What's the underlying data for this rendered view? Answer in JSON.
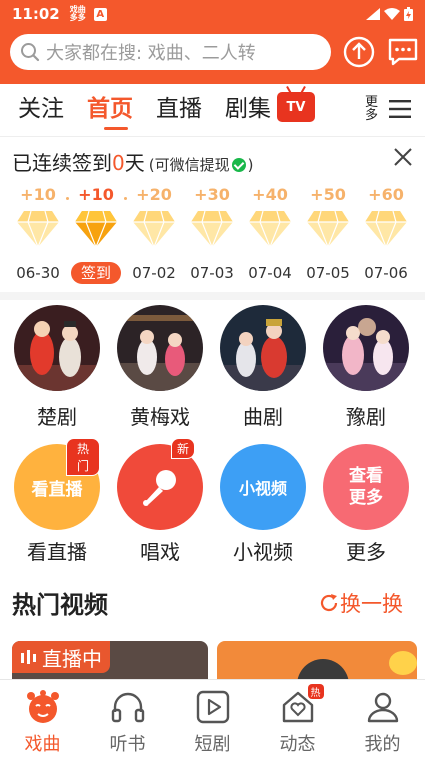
{
  "status_bar": {
    "time": "11:02",
    "app_icon_text": "戏曲多多",
    "notification_letter": "A"
  },
  "header": {
    "search_placeholder": "大家都在搜: 戏曲、二人转",
    "accent_color": "#f4582c"
  },
  "tabs": {
    "items": [
      "关注",
      "首页",
      "直播",
      "剧集"
    ],
    "active": "首页",
    "tv_badge": "TV",
    "more_text": "更多"
  },
  "checkin": {
    "title_prefix": "已连续签到",
    "days": "0",
    "title_suffix": "天",
    "note_open": "(可微信提现",
    "note_close": ")",
    "days_list": [
      {
        "points": "+10",
        "date": "06-30"
      },
      {
        "points": "+10",
        "date": "签到"
      },
      {
        "points": "+20",
        "date": "07-02"
      },
      {
        "points": "+30",
        "date": "07-03"
      },
      {
        "points": "+40",
        "date": "07-04"
      },
      {
        "points": "+50",
        "date": "07-05"
      },
      {
        "points": "+60",
        "date": "07-06"
      }
    ]
  },
  "genres": [
    {
      "label": "楚剧"
    },
    {
      "label": "黄梅戏"
    },
    {
      "label": "曲剧"
    },
    {
      "label": "豫剧"
    }
  ],
  "shortcuts": [
    {
      "circle_text": "看直播",
      "label": "看直播",
      "badge": "热门",
      "color": "#ffb23e"
    },
    {
      "circle_text": "",
      "label": "唱戏",
      "badge": "新",
      "color": "#f04a3a"
    },
    {
      "circle_text": "小视频",
      "label": "小视频",
      "badge": "",
      "color": "#3d9ff5"
    },
    {
      "circle_text": "查看更多",
      "label": "更多",
      "badge": "",
      "color": "#f76a73"
    }
  ],
  "hot": {
    "title": "热门视频",
    "refresh": "换一换",
    "live_tag": "直播中"
  },
  "bottom_nav": [
    {
      "label": "戏曲",
      "icon": "opera-mask-icon"
    },
    {
      "label": "听书",
      "icon": "headphones-icon"
    },
    {
      "label": "短剧",
      "icon": "play-box-icon"
    },
    {
      "label": "动态",
      "icon": "heart-house-icon",
      "badge": "热"
    },
    {
      "label": "我的",
      "icon": "user-icon"
    }
  ]
}
